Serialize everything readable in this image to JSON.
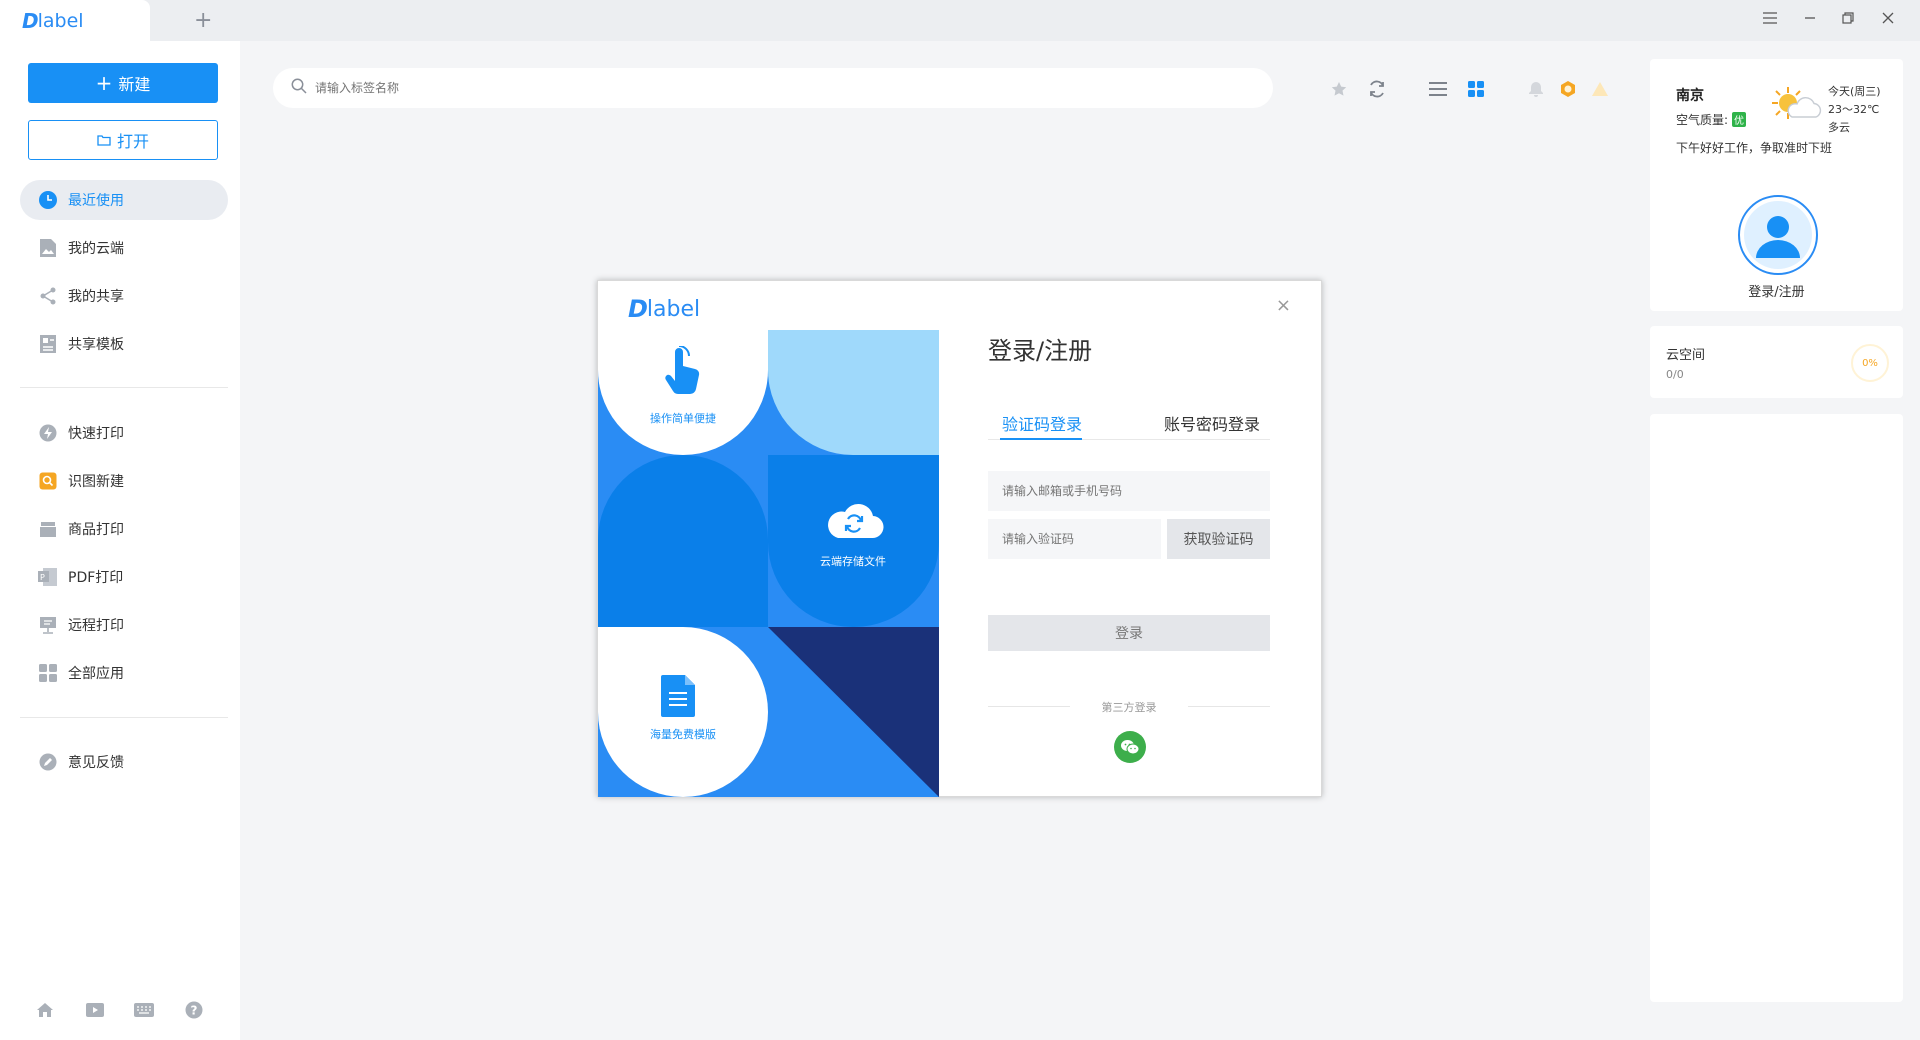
{
  "app": {
    "logo_mark": "D",
    "logo_word": "label"
  },
  "titlebar": {
    "add_tab": "+",
    "menu_icon": "menu-icon",
    "minimize_icon": "minimize-icon",
    "restore_icon": "restore-icon",
    "close_icon": "close-icon"
  },
  "sidebar": {
    "new_label": "新建",
    "open_label": "打开",
    "group1": [
      {
        "label": "最近使用",
        "icon": "clock-icon",
        "active": true
      },
      {
        "label": "我的云端",
        "icon": "cloud-image-icon"
      },
      {
        "label": "我的共享",
        "icon": "share-icon"
      },
      {
        "label": "共享模板",
        "icon": "template-icon"
      }
    ],
    "group2": [
      {
        "label": "快速打印",
        "icon": "lightning-icon"
      },
      {
        "label": "识图新建",
        "icon": "scan-icon"
      },
      {
        "label": "商品打印",
        "icon": "box-icon"
      },
      {
        "label": "PDF打印",
        "icon": "pdf-icon"
      },
      {
        "label": "远程打印",
        "icon": "remote-print-icon"
      },
      {
        "label": "全部应用",
        "icon": "apps-grid-icon"
      }
    ],
    "group3": [
      {
        "label": "意见反馈",
        "icon": "feedback-icon"
      }
    ]
  },
  "search": {
    "placeholder": "请输入标签名称"
  },
  "weather": {
    "city": "南京",
    "aq_label": "空气质量:",
    "aq_value": "优",
    "day": "今天(周三)",
    "temp": "23～32℃",
    "condition": "多云",
    "greeting": "下午好好工作，争取准时下班"
  },
  "user": {
    "login_label": "登录/注册"
  },
  "cloud_space": {
    "title": "云空间",
    "usage": "0/0",
    "percent": "0%"
  },
  "modal": {
    "title": "登录/注册",
    "close": "×",
    "hero": {
      "easy": "操作简单便捷",
      "cloud": "云端存储文件",
      "templates": "海量免费模版"
    },
    "tabs": {
      "code_login": "验证码登录",
      "password_login": "账号密码登录"
    },
    "phone_placeholder": "请输入邮箱或手机号码",
    "code_placeholder": "请输入验证码",
    "get_code": "获取验证码",
    "login_button": "登录",
    "third_party": "第三方登录"
  },
  "colors": {
    "primary": "#1890f5",
    "dark_blue": "#1a3179",
    "light_blue": "#9fd9fb",
    "wechat_green": "#3dae4b"
  }
}
